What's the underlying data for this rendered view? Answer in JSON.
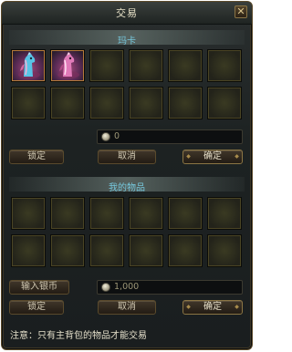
{
  "window": {
    "title": "交易"
  },
  "partner": {
    "header": "玛卡",
    "items": [
      {
        "icon": "pink-horse-mount-icon"
      },
      {
        "icon": "pink-horse-mount-icon"
      }
    ],
    "money": "0"
  },
  "mine": {
    "header": "我的物品",
    "money": "1,000"
  },
  "buttons": {
    "lock": "锁定",
    "cancel": "取消",
    "confirm": "确定",
    "input_silver": "输入银币"
  },
  "note": "注意：只有主背包的物品才能交易",
  "colors": {
    "header_text": "#76c8dd",
    "item_glow": "#a44a7a"
  }
}
